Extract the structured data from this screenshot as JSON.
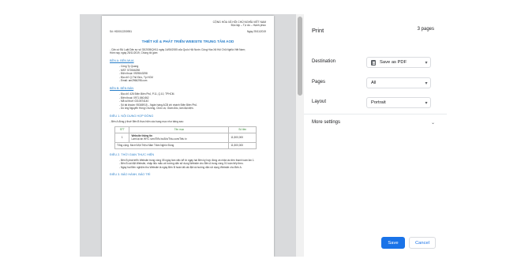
{
  "document": {
    "header_right": [
      "CỘNG HÒA XÃ HỘI CHỦ NGHĨA VIỆT NAM",
      "Độc lập – Tự do – Hạnh phúc"
    ],
    "number": "Số: HD0012200951",
    "date": "Ngày 25/11/2019",
    "title": "THIẾT KẾ & PHÁT TRIỂN WEBSITE TRUNG TÂM AOD",
    "preamble": [
      "- Căn cứ Bộ Luật Dân sự số 33/2005/QH11 ngày 14/06/2005 của Quốc Hội Nước Cộng Hòa Xã Hội Chủ Nghĩa Việt Nam;",
      "Hôm nay, ngày 25/11/2019, Chúng tôi gồm:"
    ],
    "party_a": {
      "heading": "BÊN A: BÊN MUA",
      "lines": [
        "- Công Ty Quang",
        "- MST: 572066298",
        "- Điện thoại: 0929843298",
        "- Địa chỉ: Q.Thủ Đức, Tp.HCM",
        "- Email: am2966298.com"
      ]
    },
    "party_b": {
      "heading": "BÊN B: BÊN BÁN",
      "lines": [
        "- Địa chỉ: 426 Điện Biên Phủ, P.11, Q.10, TPHCM.",
        "- Điện thoại: 0971.860.862",
        "- Mã số thuế: 0310574140",
        "- Số tài khoản: 95345915 – Ngân hàng ACB chi nhánh Điện Biên Phủ.",
        "- Do ông Nguyễn Hồng Chương, Chức vụ: Giám đốc, làm đại diện."
      ]
    },
    "article1": {
      "heading": "ĐIỀU 1. NỘI DUNG HỢP ĐỒNG",
      "intro": "- Bên A đồng ý thuê Bên B thực hiện các hạng mục như bảng sau:",
      "table": {
        "headers": [
          "STT",
          "Tên mục",
          "Số tiền"
        ],
        "rows": [
          {
            "stt": "1",
            "name": "Website thông tin",
            "desc": "Làm lại án WYC sơn/Tiểu buổi/o/Thiu.com/Tiếu tv",
            "amount": "11,500,000"
          }
        ],
        "total_label": "Tổng cộng: Mười Một Triệu Năm Trăm Nghìn Đồng",
        "total_amount": "11,500,000"
      }
    },
    "article2": {
      "heading": "ĐIỀU 2. THỜI GIAN THỰC HIỆN",
      "lines": [
        "- Bên B phát triển Website trong vòng 05 ngày làm việc kể từ ngày hai Bên ký hợp đồng và nhận ảo tiền thanh toán lần 1.",
        "- Bên B cài đặt Website, nhập liệu mẫu và hướng dẫn sử dụng Website cho Bên A trong vòng 01 tuần tiếp theo.",
        "- Ngày hai Bên nghiệm thu Website là ngày Bên B hoàn tất cài đặt và hướng dẫn sử dụng Website cho Bên A."
      ]
    },
    "article3": {
      "heading": "ĐIỀU 3. BẢO HÀNH, BẢO TRÌ"
    }
  },
  "panel": {
    "title": "Print",
    "pages_count": "3 pages",
    "destination": {
      "label": "Destination",
      "value": "Save as PDF"
    },
    "pages": {
      "label": "Pages",
      "value": "All"
    },
    "layout": {
      "label": "Layout",
      "value": "Portrait"
    },
    "more_settings": "More settings",
    "save_label": "Save",
    "cancel_label": "Cancel"
  },
  "icons": {
    "chevron": "chevron-down-icon",
    "pdf": "pdf-file-icon"
  },
  "colors": {
    "accent": "#1a73e8",
    "doc_heading": "#2a7fc9",
    "preview_bg": "#d9dadc"
  }
}
